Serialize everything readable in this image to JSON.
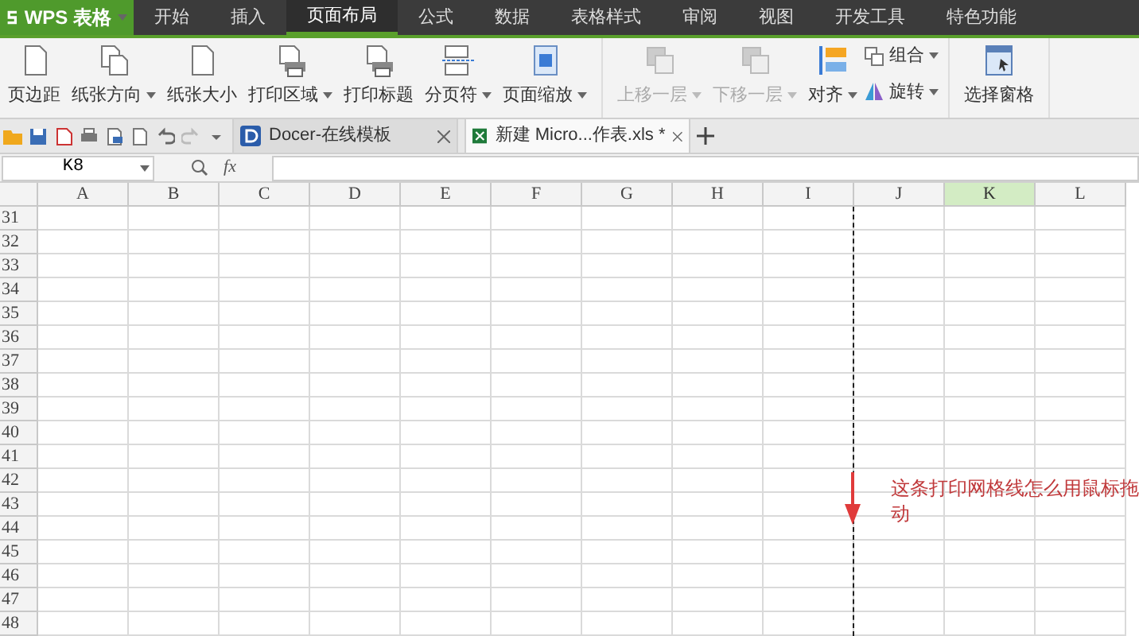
{
  "app_button": {
    "label": "WPS 表格"
  },
  "menu_tabs": [
    {
      "label": "开始",
      "selected": false
    },
    {
      "label": "插入",
      "selected": false
    },
    {
      "label": "页面布局",
      "selected": true
    },
    {
      "label": "公式",
      "selected": false
    },
    {
      "label": "数据",
      "selected": false
    },
    {
      "label": "表格样式",
      "selected": false
    },
    {
      "label": "审阅",
      "selected": false
    },
    {
      "label": "视图",
      "selected": false
    },
    {
      "label": "开发工具",
      "selected": false
    },
    {
      "label": "特色功能",
      "selected": false
    }
  ],
  "ribbon": {
    "groups": [
      {
        "buttons": [
          {
            "kind": "large",
            "label": "页边距",
            "dropdown": false,
            "disabled": false
          },
          {
            "kind": "large",
            "label": "纸张方向",
            "dropdown": true,
            "disabled": false
          },
          {
            "kind": "large",
            "label": "纸张大小",
            "dropdown": false,
            "disabled": false
          },
          {
            "kind": "large",
            "label": "打印区域",
            "dropdown": true,
            "disabled": false
          },
          {
            "kind": "large",
            "label": "打印标题",
            "dropdown": false,
            "disabled": false
          },
          {
            "kind": "large",
            "label": "分页符",
            "dropdown": true,
            "disabled": false
          },
          {
            "kind": "large",
            "label": "页面缩放",
            "dropdown": true,
            "disabled": false
          }
        ]
      },
      {
        "buttons": [
          {
            "kind": "large",
            "label": "上移一层",
            "dropdown": true,
            "disabled": true
          },
          {
            "kind": "large",
            "label": "下移一层",
            "dropdown": true,
            "disabled": true
          },
          {
            "kind": "large",
            "label": "对齐",
            "dropdown": true,
            "disabled": false
          },
          {
            "kind": "stack",
            "items": [
              {
                "label": "组合",
                "dropdown": true,
                "disabled": false
              },
              {
                "label": "旋转",
                "dropdown": true,
                "disabled": false
              }
            ]
          }
        ]
      },
      {
        "buttons": [
          {
            "kind": "large",
            "label": "选择窗格",
            "dropdown": false,
            "disabled": false
          }
        ]
      }
    ]
  },
  "doc_tabs": [
    {
      "label": "Docer-在线模板",
      "selected": false,
      "kind": "docer"
    },
    {
      "label": "新建 Micro...作表.xls *",
      "selected": true,
      "kind": "sheet"
    }
  ],
  "name_box": {
    "value": "K8"
  },
  "formula_label": "fx",
  "columns": [
    {
      "label": "A",
      "selected": false
    },
    {
      "label": "B",
      "selected": false
    },
    {
      "label": "C",
      "selected": false
    },
    {
      "label": "D",
      "selected": false
    },
    {
      "label": "E",
      "selected": false
    },
    {
      "label": "F",
      "selected": false
    },
    {
      "label": "G",
      "selected": false
    },
    {
      "label": "H",
      "selected": false
    },
    {
      "label": "I",
      "selected": false
    },
    {
      "label": "J",
      "selected": false
    },
    {
      "label": "K",
      "selected": true
    },
    {
      "label": "L",
      "selected": false
    }
  ],
  "rows": [
    "31",
    "32",
    "33",
    "34",
    "35",
    "36",
    "37",
    "38",
    "39",
    "40",
    "41",
    "42",
    "43",
    "44",
    "45",
    "46",
    "47",
    "48"
  ],
  "annotation": {
    "text": "这条打印网格线怎么用鼠标拖动"
  }
}
